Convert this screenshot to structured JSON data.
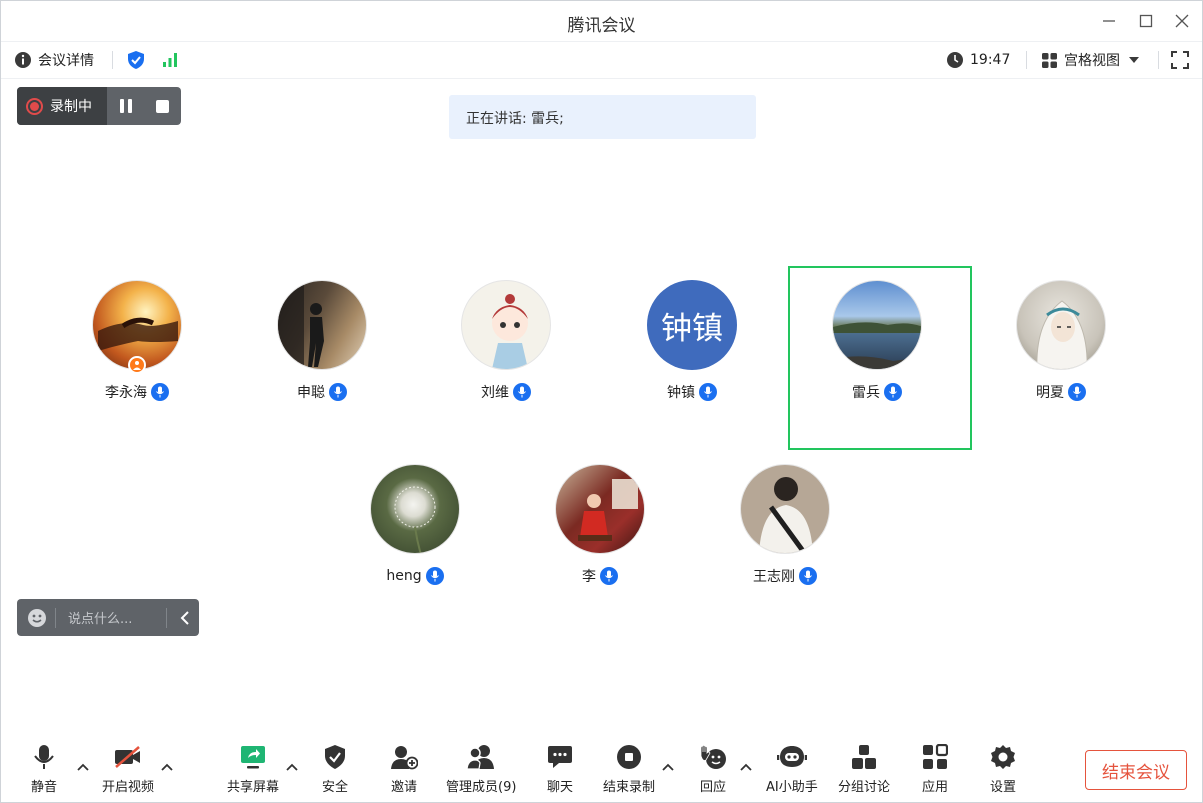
{
  "window": {
    "title": "腾讯会议"
  },
  "topbar": {
    "meeting_info_label": "会议详情",
    "time": "19:47",
    "view_label": "宫格视图"
  },
  "recording": {
    "label": "录制中"
  },
  "speaking": {
    "text": "正在讲话: 雷兵;"
  },
  "participants": [
    {
      "name": "李永海",
      "avatar": "photo-hands-sunset",
      "host": true
    },
    {
      "name": "申聪",
      "avatar": "photo-walking-street"
    },
    {
      "name": "刘维",
      "avatar": "cartoon-character"
    },
    {
      "name": "钟镇",
      "avatar_text": "钟镇",
      "avatar_color": "#3f6bbd"
    },
    {
      "name": "雷兵",
      "avatar": "photo-lake",
      "speaking": true
    },
    {
      "name": "明夏",
      "avatar": "illustration-girl"
    },
    {
      "name": "heng",
      "avatar": "photo-dandelion"
    },
    {
      "name": "李",
      "avatar": "photo-child-red"
    },
    {
      "name": "王志刚",
      "avatar": "photo-person-back"
    }
  ],
  "chat": {
    "placeholder": "说点什么..."
  },
  "bottombar": {
    "mute": "静音",
    "video": "开启视频",
    "share": "共享屏幕",
    "security": "安全",
    "invite": "邀请",
    "members": "管理成员(9)",
    "chat": "聊天",
    "end_record": "结束录制",
    "react": "回应",
    "ai": "AI小助手",
    "breakout": "分组讨论",
    "apps": "应用",
    "settings": "设置",
    "end_meeting": "结束会议"
  },
  "colors": {
    "accent_blue": "#1a6ff0",
    "speaking_green": "#22c55e",
    "end_red": "#e5533d",
    "share_green": "#1fb573"
  }
}
